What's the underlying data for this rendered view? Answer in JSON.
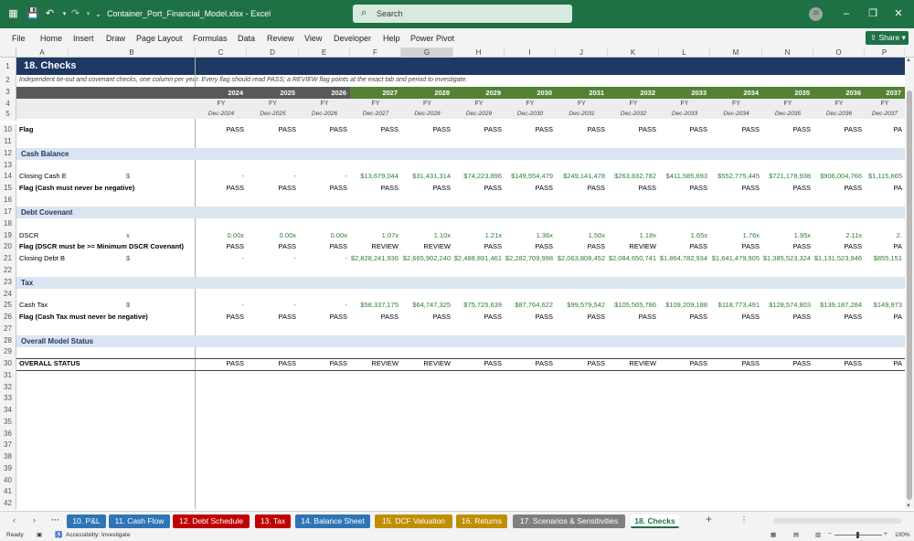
{
  "app": {
    "file_name": "Container_Port_Financial_Model.xlsx",
    "app_name": "Excel",
    "separator": "-",
    "search_placeholder": "Search",
    "user_initials": "JS"
  },
  "menu": [
    "File",
    "Home",
    "Insert",
    "Draw",
    "Page Layout",
    "Formulas",
    "Data",
    "Review",
    "View",
    "Developer",
    "Help",
    "Power Pivot"
  ],
  "share_label": "Share",
  "columns": [
    "A",
    "B",
    "C",
    "D",
    "E",
    "F",
    "G",
    "H",
    "I",
    "J",
    "K",
    "L",
    "M",
    "N",
    "O",
    "P"
  ],
  "selected_column": "G",
  "row_numbers": [
    "1",
    "2",
    "3",
    "4",
    "5",
    "10",
    "11",
    "12",
    "13",
    "14",
    "15",
    "16",
    "17",
    "18",
    "19",
    "20",
    "21",
    "22",
    "23",
    "24",
    "25",
    "26",
    "27",
    "28",
    "29",
    "30",
    "31",
    "32",
    "33",
    "34",
    "35",
    "36",
    "37",
    "38",
    "39",
    "40",
    "41",
    "42"
  ],
  "sheet": {
    "title": "18. Checks",
    "subtitle": "Independent tie-out and covenant checks, one column per year. Every flag should read PASS; a REVIEW flag points at the exact tab and period to investigate.",
    "years": [
      "2024",
      "2025",
      "2026",
      "2027",
      "2028",
      "2029",
      "2030",
      "2031",
      "2032",
      "2033",
      "2034",
      "2035",
      "2036",
      "2037"
    ],
    "historic_count": 3,
    "period_type": "FY",
    "period_dates": [
      "Dec-2024",
      "Dec-2025",
      "Dec-2026",
      "Dec-2027",
      "Dec-2028",
      "Dec-2029",
      "Dec-2030",
      "Dec-2031",
      "Dec-2032",
      "Dec-2033",
      "Dec-2034",
      "Dec-2035",
      "Dec-2036",
      "Dec-2037"
    ],
    "flag_row": {
      "label": "Flag",
      "values": [
        "PASS",
        "PASS",
        "PASS",
        "PASS",
        "PASS",
        "PASS",
        "PASS",
        "PASS",
        "PASS",
        "PASS",
        "PASS",
        "PASS",
        "PASS",
        "PA"
      ]
    },
    "sections": [
      {
        "name": "Cash Balance",
        "rows": [
          {
            "label": "Closing Cash E",
            "unit": "$",
            "bold": false,
            "green": true,
            "values": [
              "-",
              "-",
              "-",
              "$13,679,044",
              "$31,431,314",
              "$74,223,896",
              "$149,554,479",
              "$249,141,478",
              "$263,832,782",
              "$411,585,693",
              "$552,775,445",
              "$721,178,938",
              "$906,004,766",
              "$1,115,665"
            ]
          },
          {
            "label": "Flag (Cash must never be negative)",
            "unit": "",
            "bold": true,
            "green": false,
            "values": [
              "PASS",
              "PASS",
              "PASS",
              "PASS",
              "PASS",
              "PASS",
              "PASS",
              "PASS",
              "PASS",
              "PASS",
              "PASS",
              "PASS",
              "PASS",
              "PA"
            ]
          }
        ]
      },
      {
        "name": "Debt Covenant",
        "rows": [
          {
            "label": "DSCR",
            "unit": "x",
            "bold": false,
            "green": true,
            "values": [
              "0.00x",
              "0.00x",
              "0.00x",
              "1.07x",
              "1.10x",
              "1.21x",
              "1.36x",
              "1.50x",
              "1.18x",
              "1.65x",
              "1.76x",
              "1.95x",
              "2.11x",
              "2."
            ]
          },
          {
            "label": "Flag (DSCR must be >= Minimum DSCR Covenant)",
            "unit": "",
            "bold": true,
            "green": false,
            "values": [
              "PASS",
              "PASS",
              "PASS",
              "REVIEW",
              "REVIEW",
              "PASS",
              "PASS",
              "PASS",
              "REVIEW",
              "PASS",
              "PASS",
              "PASS",
              "PASS",
              "PA"
            ]
          },
          {
            "label": "Closing Debt B",
            "unit": "$",
            "bold": false,
            "green": true,
            "values": [
              "-",
              "-",
              "-",
              "$2,828,241,936",
              "$2,665,902,240",
              "$2,488,891,461",
              "$2,282,709,998",
              "$2,063,808,452",
              "$2,084,650,741",
              "$1,864,782,934",
              "$1,641,479,905",
              "$1,385,523,324",
              "$1,131,523,946",
              "$855,151"
            ]
          }
        ]
      },
      {
        "name": "Tax",
        "rows": [
          {
            "label": "Cash Tax",
            "unit": "$",
            "bold": false,
            "green": true,
            "values": [
              "-",
              "-",
              "-",
              "$58,337,175",
              "$64,747,325",
              "$75,725,639",
              "$87,764,622",
              "$99,579,542",
              "$105,565,786",
              "$109,209,188",
              "$118,773,491",
              "$128,574,803",
              "$139,187,284",
              "$149,973"
            ]
          },
          {
            "label": "Flag (Cash Tax must never be negative)",
            "unit": "",
            "bold": true,
            "green": false,
            "values": [
              "PASS",
              "PASS",
              "PASS",
              "PASS",
              "PASS",
              "PASS",
              "PASS",
              "PASS",
              "PASS",
              "PASS",
              "PASS",
              "PASS",
              "PASS",
              "PA"
            ]
          }
        ]
      },
      {
        "name": "Overall Model Status",
        "rows": []
      }
    ],
    "overall": {
      "label": "OVERALL STATUS",
      "values": [
        "PASS",
        "PASS",
        "PASS",
        "REVIEW",
        "REVIEW",
        "PASS",
        "PASS",
        "PASS",
        "REVIEW",
        "PASS",
        "PASS",
        "PASS",
        "PASS",
        "PA"
      ]
    }
  },
  "tabs": [
    {
      "label": "10. P&L",
      "color": "#2e75b6"
    },
    {
      "label": "11. Cash Flow",
      "color": "#2e75b6"
    },
    {
      "label": "12. Debt Schedule",
      "color": "#c00000"
    },
    {
      "label": "13. Tax",
      "color": "#c00000"
    },
    {
      "label": "14. Balance Sheet",
      "color": "#2e75b6"
    },
    {
      "label": "15. DCF Valuation",
      "color": "#bf8f00"
    },
    {
      "label": "16. Returns",
      "color": "#bf8f00"
    },
    {
      "label": "17. Scenarios & Sensitivities",
      "color": "#7f7f7f"
    },
    {
      "label": "18. Checks",
      "color": "#ffffff"
    }
  ],
  "status": {
    "ready": "Ready",
    "accessibility": "Accessibility: Investigate",
    "zoom": "100%"
  }
}
